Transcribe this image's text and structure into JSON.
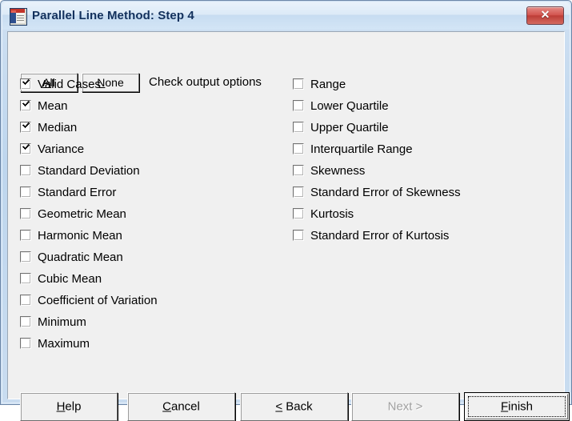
{
  "window": {
    "title": "Parallel Line Method: Step 4",
    "icon": "app-document-icon",
    "close_label": "✕",
    "titlebar_color": "#d3e5f6",
    "frame_color": "#bed6ee",
    "client_bg": "#f0f0f0"
  },
  "toolbar": {
    "all_label": "All",
    "all_mnemonic": "A",
    "none_label": "None",
    "none_mnemonic": "N",
    "instruction": "Check output options"
  },
  "options": {
    "left_column": [
      {
        "label": "Valid Cases",
        "checked": true
      },
      {
        "label": "Mean",
        "checked": true
      },
      {
        "label": "Median",
        "checked": true
      },
      {
        "label": "Variance",
        "checked": true
      },
      {
        "label": "Standard Deviation",
        "checked": false
      },
      {
        "label": "Standard Error",
        "checked": false
      },
      {
        "label": "Geometric Mean",
        "checked": false
      },
      {
        "label": "Harmonic Mean",
        "checked": false
      },
      {
        "label": "Quadratic Mean",
        "checked": false
      },
      {
        "label": "Cubic Mean",
        "checked": false
      },
      {
        "label": "Coefficient of Variation",
        "checked": false
      },
      {
        "label": "Minimum",
        "checked": false
      },
      {
        "label": "Maximum",
        "checked": false
      }
    ],
    "right_column": [
      {
        "label": "Range",
        "checked": false
      },
      {
        "label": "Lower Quartile",
        "checked": false
      },
      {
        "label": "Upper Quartile",
        "checked": false
      },
      {
        "label": "Interquartile Range",
        "checked": false
      },
      {
        "label": "Skewness",
        "checked": false
      },
      {
        "label": "Standard Error of Skewness",
        "checked": false
      },
      {
        "label": "Kurtosis",
        "checked": false
      },
      {
        "label": "Standard Error of Kurtosis",
        "checked": false
      }
    ]
  },
  "buttons": {
    "help": {
      "label": "Help",
      "mnemonic": "H",
      "enabled": true,
      "default": false
    },
    "cancel": {
      "label": "Cancel",
      "mnemonic": "C",
      "enabled": true,
      "default": false
    },
    "back": {
      "label": "< Back",
      "mnemonic": "<",
      "enabled": true,
      "default": false
    },
    "next": {
      "label": "Next >",
      "mnemonic": "",
      "enabled": false,
      "default": false
    },
    "finish": {
      "label": "Finish",
      "mnemonic": "F",
      "enabled": true,
      "default": true
    }
  }
}
